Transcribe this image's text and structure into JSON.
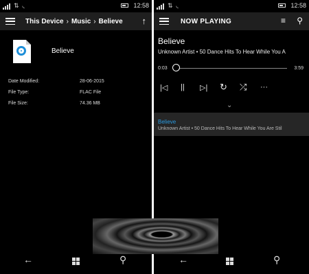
{
  "left": {
    "status": {
      "time": "12:58"
    },
    "breadcrumb": [
      "This Device",
      "Music",
      "Believe"
    ],
    "breadcrumb_sep": "›",
    "file_name": "Believe",
    "properties": [
      {
        "label": "Date Modified:",
        "value": "28-06-2015"
      },
      {
        "label": "File Type:",
        "value": "FLAC File"
      },
      {
        "label": "File Size:",
        "value": "74.36 MB"
      }
    ]
  },
  "right": {
    "status": {
      "time": "12:58"
    },
    "header_title": "NOW PLAYING",
    "song_title": "Believe",
    "subtitle": "Unknown Artist • 50 Dance Hits To Hear While You A",
    "elapsed": "0:03",
    "duration": "3:59",
    "progress_fraction": 0.01,
    "queue_item": {
      "title": "Believe",
      "subtitle": "Unknown Artist • 50 Dance Hits To Hear While You Are Stil"
    }
  },
  "icons": {
    "hamburger": "hamburger-icon",
    "up": "↑",
    "up_name": "up-arrow-icon",
    "playlist": "≡",
    "search": "⚲",
    "prev": "|◁",
    "pause": "||",
    "next": "▷|",
    "repeat": "↻",
    "shuffle": "⤮",
    "more": "···",
    "chevron": "⌄",
    "back": "←",
    "nav_search": "⚲"
  },
  "colors": {
    "accent": "#1f8fd8",
    "header_bg": "#1f1f1f",
    "queue_bg": "#262626"
  }
}
